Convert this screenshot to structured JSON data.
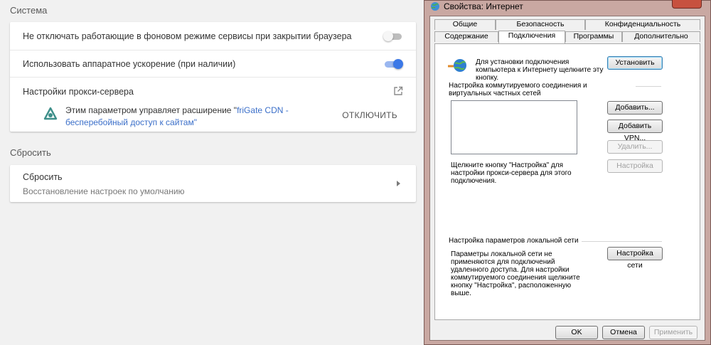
{
  "settings": {
    "system_title": "Система",
    "system_rows": {
      "background_label": "Не отключать работающие в фоновом режиме сервисы при закрытии браузера",
      "background_state": "off",
      "hw_accel_label": "Использовать аппаратное ускорение (при наличии)",
      "hw_accel_state": "on",
      "proxy_label": "Настройки прокси-сервера",
      "extension_text_before": "Этим параметром управляет расширение \"",
      "extension_link": "friGate CDN - бесперебойный доступ к сайтам",
      "extension_text_after": "\"",
      "disable_button": "ОТКЛЮЧИТЬ"
    },
    "reset_title": "Сбросить",
    "reset_row": {
      "title": "Сбросить",
      "subtitle": "Восстановление настроек по умолчанию"
    }
  },
  "dialog": {
    "title": "Свойства: Интернет",
    "tabs_top": [
      "Общие",
      "Безопасность",
      "Конфиденциальность"
    ],
    "tabs_bottom": [
      "Содержание",
      "Подключения",
      "Программы",
      "Дополнительно"
    ],
    "active_tab": "Подключения",
    "setup_text": "Для установки подключения компьютера к Интернету щелкните эту кнопку.",
    "setup_button": "Установить",
    "dialup_group": "Настройка коммутируемого соединения и виртуальных частных сетей",
    "add_button": "Добавить...",
    "add_vpn_button": "Добавить VPN...",
    "remove_button": "Удалить...",
    "settings_button": "Настройка",
    "proxy_hint": "Щелкните кнопку \"Настройка\" для настройки прокси-сервера для этого подключения.",
    "lan_group": "Настройка параметров локальной сети",
    "lan_text": "Параметры локальной сети не применяются для подключений удаленного доступа. Для настройки коммутируемого соединения щелкните кнопку \"Настройка\", расположенную выше.",
    "lan_button": "Настройка сети",
    "ok_button": "OK",
    "cancel_button": "Отмена",
    "apply_button": "Применить"
  }
}
